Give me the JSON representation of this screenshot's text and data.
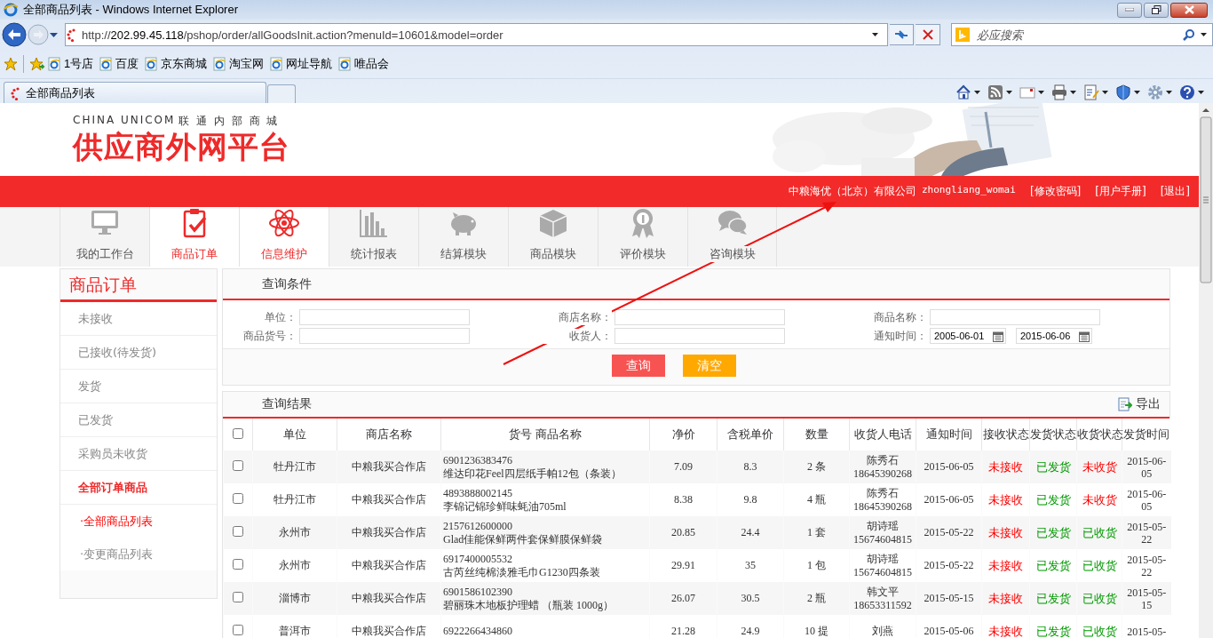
{
  "window": {
    "title": "全部商品列表 - Windows Internet Explorer"
  },
  "address_bar": {
    "url": "http://202.99.45.118/pshop/order/allGoodsInit.action?menuId=10601&model=order"
  },
  "search": {
    "placeholder": "必应搜索"
  },
  "favorites": [
    "1号店",
    "百度",
    "京东商城",
    "淘宝网",
    "网址导航",
    "唯品会"
  ],
  "tabs": [
    {
      "label": "全部商品列表",
      "selected": true
    }
  ],
  "header": {
    "brand_en": "CHINA UNICOM",
    "brand_cn": "联 通 内 部 商 城",
    "logo": "供应商外网平台"
  },
  "user_bar": {
    "company": "中粮海优（北京）有限公司",
    "username": "zhongliang_womai",
    "links": [
      "[修改密码]",
      "[用户手册]",
      "[退出]"
    ]
  },
  "nav": [
    {
      "label": "我的工作台",
      "selected": false
    },
    {
      "label": "商品订单",
      "selected": true
    },
    {
      "label": "信息维护",
      "selected": true
    },
    {
      "label": "统计报表",
      "selected": false
    },
    {
      "label": "结算模块",
      "selected": false
    },
    {
      "label": "商品模块",
      "selected": false
    },
    {
      "label": "评价模块",
      "selected": false
    },
    {
      "label": "咨询模块",
      "selected": false
    }
  ],
  "sidebar": {
    "title": "商品订单",
    "items": [
      {
        "label": "未接收",
        "kind": "item",
        "selected": false
      },
      {
        "label": "已接收(待发货)",
        "kind": "item",
        "selected": false
      },
      {
        "label": "发货",
        "kind": "item",
        "selected": false
      },
      {
        "label": "已发货",
        "kind": "item",
        "selected": false
      },
      {
        "label": "采购员未收货",
        "kind": "item",
        "selected": false
      },
      {
        "label": "全部订单商品",
        "kind": "item",
        "selected": true
      },
      {
        "label": "·全部商品列表",
        "kind": "sub",
        "selected": true
      },
      {
        "label": "·变更商品列表",
        "kind": "sub",
        "selected": false
      }
    ]
  },
  "query": {
    "title": "查询条件",
    "fields": [
      {
        "label": "单位：",
        "kind": "text"
      },
      {
        "label": "商店名称：",
        "kind": "text"
      },
      {
        "label": "商品名称：",
        "kind": "text"
      },
      {
        "label": "商品货号：",
        "kind": "text"
      },
      {
        "label": "收货人：",
        "kind": "text"
      },
      {
        "label": "通知时间：",
        "kind": "date_range",
        "values": [
          "2005-06-01",
          "2015-06-06"
        ]
      }
    ],
    "buttons": [
      {
        "label": "查询",
        "color": "#f85353"
      },
      {
        "label": "清空",
        "color": "#ffa800"
      }
    ]
  },
  "results": {
    "title": "查询结果",
    "export": "导出",
    "select_all_checked": false,
    "columns": [
      "单位",
      "商店名称",
      "货号 商品名称",
      "净价",
      "含税单价",
      "数量",
      "收货人电话",
      "通知时间",
      "接收状态",
      "发货状态",
      "收货状态",
      "发货时间"
    ],
    "rows": [
      {
        "checked": false,
        "unit": "牡丹江市",
        "shop": "中粮我买合作店",
        "code": "6901236383476",
        "name": "维达印花Feel四层纸手帕12包（条装）",
        "price": "7.09",
        "tax_price": "8.3",
        "qty": "2 条",
        "receiver": "陈秀石",
        "phone": "18645390268",
        "date": "2015-06-05",
        "statuses": [
          {
            "text": "未接收",
            "color": "#ff0000"
          },
          {
            "text": "已发货",
            "color": "#009900"
          },
          {
            "text": "未收货",
            "color": "#ff0000"
          }
        ],
        "ship_time": "2015-06-05"
      },
      {
        "checked": false,
        "unit": "牡丹江市",
        "shop": "中粮我买合作店",
        "code": "4893888002145",
        "name": "李锦记锦珍鲜味蚝油705ml",
        "price": "8.38",
        "tax_price": "9.8",
        "qty": "4 瓶",
        "receiver": "陈秀石",
        "phone": "18645390268",
        "date": "2015-06-05",
        "statuses": [
          {
            "text": "未接收",
            "color": "#ff0000"
          },
          {
            "text": "已发货",
            "color": "#009900"
          },
          {
            "text": "未收货",
            "color": "#ff0000"
          }
        ],
        "ship_time": "2015-06-05"
      },
      {
        "checked": false,
        "unit": "永州市",
        "shop": "中粮我买合作店",
        "code": "2157612600000",
        "name": "Glad佳能保鲜两件套保鲜膜保鲜袋",
        "price": "20.85",
        "tax_price": "24.4",
        "qty": "1 套",
        "receiver": "胡诗瑶",
        "phone": "15674604815",
        "date": "2015-05-22",
        "statuses": [
          {
            "text": "未接收",
            "color": "#ff0000"
          },
          {
            "text": "已发货",
            "color": "#009900"
          },
          {
            "text": "已收货",
            "color": "#009900"
          }
        ],
        "ship_time": "2015-05-22"
      },
      {
        "checked": false,
        "unit": "永州市",
        "shop": "中粮我买合作店",
        "code": "6917400005532",
        "name": "古芮丝纯棉淡雅毛巾G1230四条装",
        "price": "29.91",
        "tax_price": "35",
        "qty": "1 包",
        "receiver": "胡诗瑶",
        "phone": "15674604815",
        "date": "2015-05-22",
        "statuses": [
          {
            "text": "未接收",
            "color": "#ff0000"
          },
          {
            "text": "已发货",
            "color": "#009900"
          },
          {
            "text": "已收货",
            "color": "#009900"
          }
        ],
        "ship_time": "2015-05-22"
      },
      {
        "checked": false,
        "unit": "淄博市",
        "shop": "中粮我买合作店",
        "code": "6901586102390",
        "name": "碧丽珠木地板护理蜡 （瓶装 1000g）",
        "price": "26.07",
        "tax_price": "30.5",
        "qty": "2 瓶",
        "receiver": "韩文平",
        "phone": "18653311592",
        "date": "2015-05-15",
        "statuses": [
          {
            "text": "未接收",
            "color": "#ff0000"
          },
          {
            "text": "已发货",
            "color": "#009900"
          },
          {
            "text": "已收货",
            "color": "#009900"
          }
        ],
        "ship_time": "2015-05-15"
      },
      {
        "checked": false,
        "unit": "普洱市",
        "shop": "中粮我买合作店",
        "code": "6922266434860",
        "price": "21.28",
        "tax_price": "24.9",
        "qty": "10 提",
        "receiver": "刘燕",
        "date": "2015-05-06",
        "statuses": [
          {
            "text": "未接收",
            "color": "#ff0000"
          },
          {
            "text": "已发货",
            "color": "#009900"
          },
          {
            "text": "已收货",
            "color": "#009900"
          }
        ],
        "ship_time": "2015-05-"
      }
    ]
  }
}
